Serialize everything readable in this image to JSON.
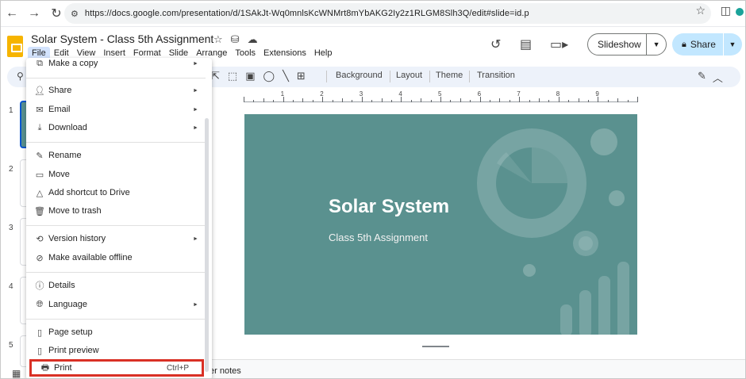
{
  "browser": {
    "url": "https://docs.google.com/presentation/d/1SAkJt-Wq0mnlsKcWNMrt8mYbAKG2Iy2z1RLGM8Slh3Q/edit#slide=id.p"
  },
  "doc": {
    "title": "Solar System - Class  5th Assignment"
  },
  "menubar": [
    "File",
    "Edit",
    "View",
    "Insert",
    "Format",
    "Slide",
    "Arrange",
    "Tools",
    "Extensions",
    "Help"
  ],
  "header": {
    "slideshow_label": "Slideshow",
    "share_label": "Share"
  },
  "toolbar": {
    "background": "Background",
    "layout": "Layout",
    "theme": "Theme",
    "transition": "Transition"
  },
  "filmstrip": [
    "1",
    "2",
    "3",
    "4",
    "5"
  ],
  "ruler": [
    "1",
    "2",
    "3",
    "4",
    "5",
    "6",
    "7",
    "8",
    "9"
  ],
  "slide": {
    "title": "Solar System",
    "subtitle": "Class 5th Assignment",
    "background_color": "#5a918f"
  },
  "notes": {
    "placeholder": "er notes"
  },
  "file_menu": {
    "items": [
      {
        "label": "Make a copy",
        "icon": "copy-icon",
        "submenu": true
      },
      {
        "label": "Share",
        "icon": "person-add-icon",
        "submenu": true
      },
      {
        "label": "Email",
        "icon": "email-icon",
        "submenu": true
      },
      {
        "label": "Download",
        "icon": "download-icon",
        "submenu": true
      },
      {
        "label": "Rename",
        "icon": "pencil-icon",
        "submenu": false
      },
      {
        "label": "Move",
        "icon": "folder-move-icon",
        "submenu": false
      },
      {
        "label": "Add shortcut to Drive",
        "icon": "drive-shortcut-icon",
        "submenu": false
      },
      {
        "label": "Move to trash",
        "icon": "trash-icon",
        "submenu": false
      },
      {
        "label": "Version history",
        "icon": "history-icon",
        "submenu": true
      },
      {
        "label": "Make available offline",
        "icon": "offline-icon",
        "submenu": false
      },
      {
        "label": "Details",
        "icon": "info-icon",
        "submenu": false
      },
      {
        "label": "Language",
        "icon": "globe-icon",
        "submenu": true
      },
      {
        "label": "Page setup",
        "icon": "page-setup-icon",
        "submenu": false
      },
      {
        "label": "Print preview",
        "icon": "print-preview-icon",
        "submenu": false
      },
      {
        "label": "Print",
        "icon": "printer-icon",
        "submenu": false,
        "shortcut": "Ctrl+P",
        "highlighted": true
      }
    ]
  },
  "colors": {
    "accent_blue": "#0b57d0",
    "share_bg": "#c2e7ff",
    "highlight_red": "#d93025"
  }
}
